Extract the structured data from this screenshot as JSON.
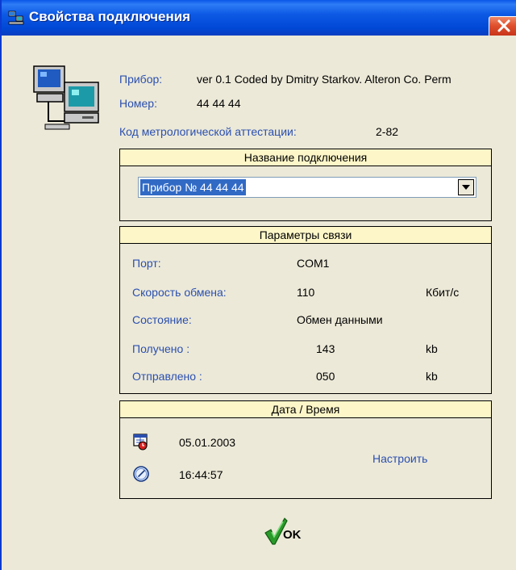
{
  "window": {
    "title": "Свойства подключения"
  },
  "device_info": {
    "device_label": "Прибор:",
    "device_value": "ver 0.1 Coded by Dmitry Starkov. Alteron Co. Perm",
    "number_label": "Номер:",
    "number_value": "44 44 44",
    "metro_label": "Код метрологической аттестации:",
    "metro_value": "2-82"
  },
  "connection_name": {
    "header": "Название подключения",
    "selected": "Прибор № 44 44 44"
  },
  "comm_params": {
    "header": "Параметры связи",
    "port_label": "Порт:",
    "port_value": "COM1",
    "speed_label": "Скорость обмена:",
    "speed_value": "110",
    "speed_unit": "Кбит/с",
    "state_label": "Состояние:",
    "state_value": "Обмен данными",
    "received_label": "Получено :",
    "received_value": "143",
    "received_unit": "kb",
    "sent_label": "Отправлено :",
    "sent_value": "050",
    "sent_unit": "kb"
  },
  "datetime": {
    "header": "Дата / Время",
    "date": "05.01.2003",
    "time": "16:44:57",
    "configure_link": "Настроить"
  },
  "buttons": {
    "ok_label": "OK"
  },
  "colors": {
    "titlebar": "#0047d5",
    "label_blue": "#2a4fb0",
    "group_header": "#fdf6c8",
    "selection": "#316ac5"
  },
  "icons": {
    "app": "network-computers-icon",
    "dialog": "computers-icon",
    "calendar": "calendar-icon",
    "clock": "clock-icon",
    "ok": "checkmark-icon",
    "close": "close-icon"
  }
}
